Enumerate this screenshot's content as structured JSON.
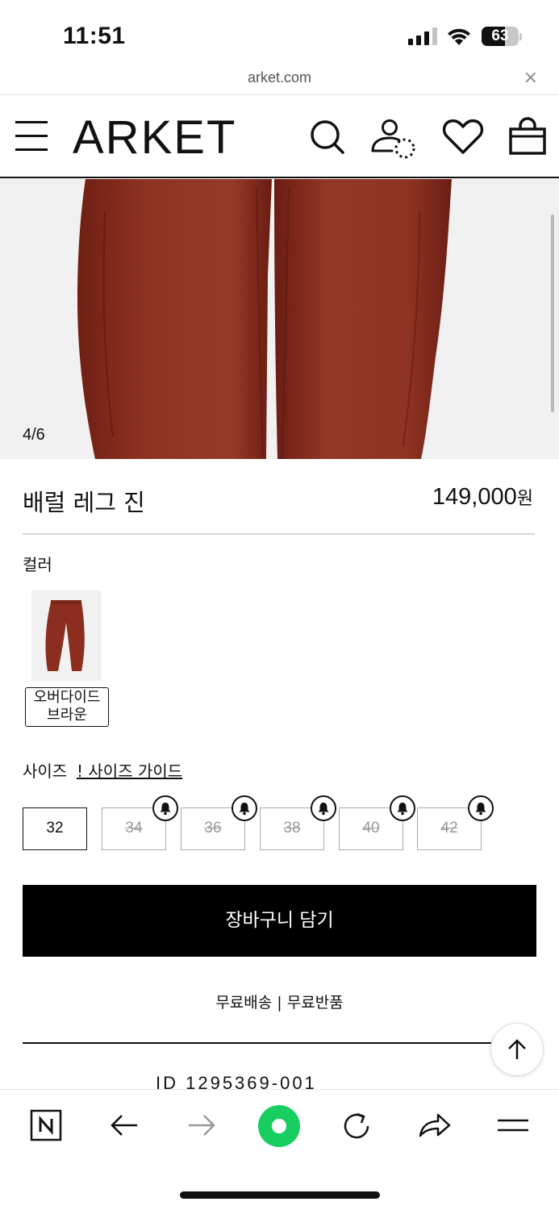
{
  "status_bar": {
    "time": "11:51",
    "battery_level": "63"
  },
  "browser": {
    "url": "arket.com",
    "close_icon": "×"
  },
  "header": {
    "logo": "ARKET",
    "icons": [
      "menu-icon",
      "search-icon",
      "account-icon",
      "wishlist-icon",
      "bag-icon"
    ]
  },
  "gallery": {
    "counter": "4/6",
    "product_color": "#8b2e1f"
  },
  "product": {
    "title": "배럴 레그 진",
    "price": "149,000",
    "currency": "원"
  },
  "color_section": {
    "label": "컬러",
    "swatch_name_line1": "오버다이드",
    "swatch_name_line2": "브라운"
  },
  "size_section": {
    "label": "사이즈",
    "guide_marker": "!",
    "guide_link": "사이즈 가이드",
    "sizes": [
      {
        "label": "32",
        "available": true
      },
      {
        "label": "34",
        "available": false
      },
      {
        "label": "36",
        "available": false
      },
      {
        "label": "38",
        "available": false
      },
      {
        "label": "40",
        "available": false
      },
      {
        "label": "42",
        "available": false
      }
    ]
  },
  "cart": {
    "button_label": "장바구니 담기"
  },
  "shipping": {
    "text": "무료배송 | 무료반품"
  },
  "product_id": {
    "text": "ID   1295369-001"
  },
  "browser_toolbar": {
    "icons": [
      "naver-icon",
      "back-icon",
      "forward-icon",
      "green-dot-icon",
      "reload-icon",
      "share-icon",
      "menu-icon"
    ],
    "accent": "#19ce60"
  }
}
